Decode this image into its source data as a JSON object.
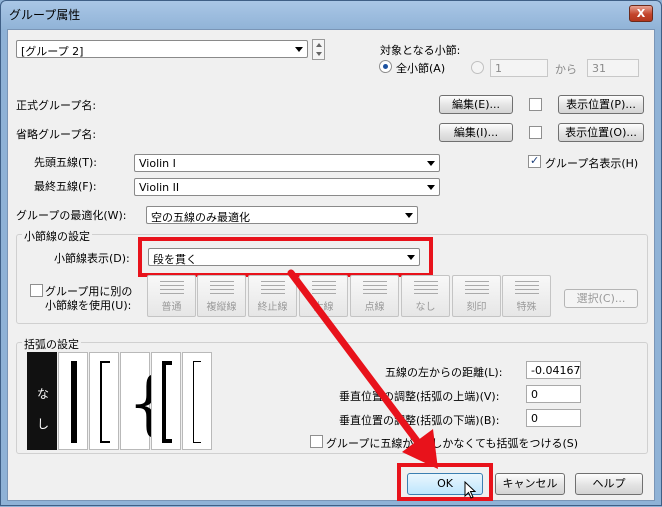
{
  "window": {
    "title": "グループ属性",
    "close_symbol": "X"
  },
  "group_select": {
    "value": "[グループ 2]"
  },
  "target_measures": {
    "label": "対象となる小節:",
    "all_label": "全小節(A)",
    "from_value": "1",
    "from_text": "から",
    "to_value": "31"
  },
  "full_name": {
    "label": "正式グループ名:",
    "edit_button": "編集(E)...",
    "position_button": "表示位置(P)..."
  },
  "abbr_name": {
    "label": "省略グループ名:",
    "edit_button": "編集(I)...",
    "position_button": "表示位置(O)..."
  },
  "show_group_name": {
    "label": "グループ名表示(H)",
    "checked": true
  },
  "first_staff": {
    "label": "先頭五線(T):",
    "value": "Violin I"
  },
  "last_staff": {
    "label": "最終五線(F):",
    "value": "Violin II"
  },
  "optimization": {
    "label": "グループの最適化(W):",
    "value": "空の五線のみ最適化"
  },
  "barline_settings": {
    "title": "小節線の設定",
    "display_label": "小節線表示(D):",
    "display_value": "段を貫く",
    "use_group_label_line1": "グループ用に別の",
    "use_group_label_line2": "小節線を使用(U):",
    "styles": [
      "普通",
      "複縦線",
      "終止線",
      "太線",
      "点線",
      "なし",
      "刻印",
      "特殊"
    ],
    "select_button": "選択(C)..."
  },
  "bracket_settings": {
    "title": "括弧の設定",
    "none_option": "な し",
    "distance_label": "五線の左からの距離(L):",
    "distance_value": "-0.04167",
    "vpos_top_label": "垂直位置の調整(括弧の上端)(V):",
    "vpos_top_value": "0",
    "vpos_bottom_label": "垂直位置の調整(括弧の下端)(B):",
    "vpos_bottom_value": "0",
    "single_staff_label": "グループに五線が1本しかなくても括弧をつける(S)"
  },
  "buttons": {
    "ok": "OK",
    "cancel": "キャンセル",
    "help": "ヘルプ"
  },
  "annotation": {
    "color": "#e8121b"
  }
}
